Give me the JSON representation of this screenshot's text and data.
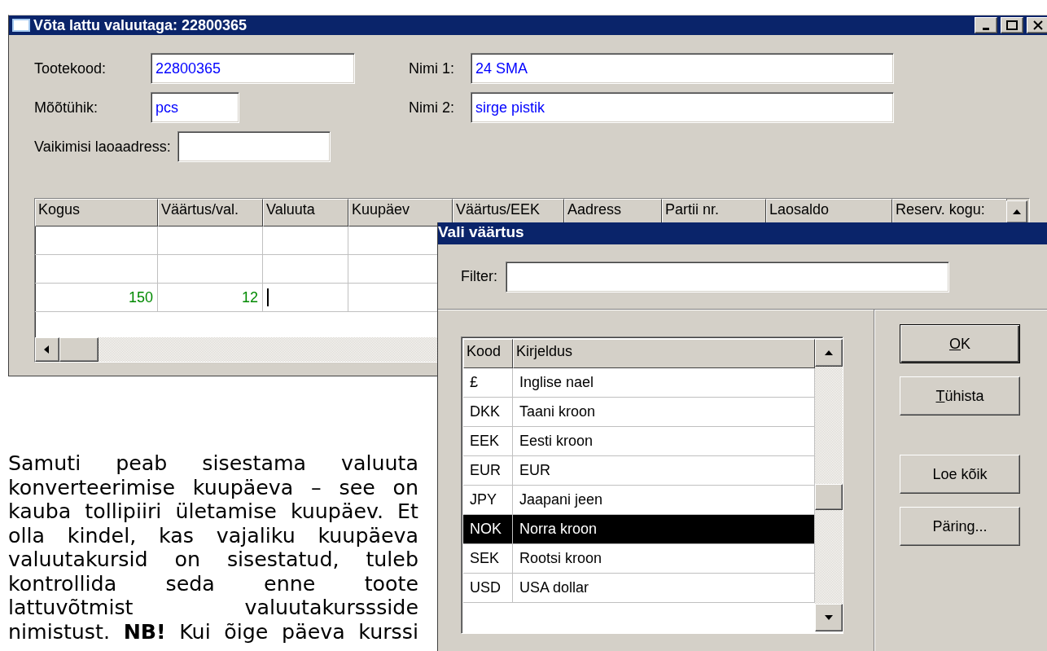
{
  "main_window": {
    "title": "Võta lattu valuutaga: 22800365",
    "left_fields": [
      {
        "label": "Tootekood:",
        "value": "22800365"
      },
      {
        "label": "Mõõtühik:",
        "value": "pcs"
      },
      {
        "label": "Vaikimisi laoaadress:"
      }
    ],
    "right_fields": [
      {
        "label": "Nimi 1:",
        "value": "24 SMA"
      },
      {
        "label": "Nimi 2:",
        "value": "sirge pistik"
      }
    ],
    "grid": {
      "columns": [
        "Kogus",
        "Väärtus/val.",
        "Valuuta",
        "Kuupäev",
        "Väärtus/EEK",
        "Aadress",
        "Partii nr.",
        "Laosaldo",
        "Reserv. kogu:"
      ],
      "rows": [
        {
          "kind": "blank"
        },
        {
          "kind": "blank"
        },
        {
          "kind": "entry",
          "cells": [
            "150",
            "12"
          ],
          "editing": true
        }
      ]
    }
  },
  "dialog": {
    "title": "Vali väärtus",
    "filter_label": "Filter:",
    "list": {
      "columns": [
        "Kood",
        "Kirjeldus"
      ],
      "rows": [
        {
          "code": "£",
          "description": "Inglise nael",
          "selected": false
        },
        {
          "code": "DKK",
          "description": "Taani kroon",
          "selected": false
        },
        {
          "code": "EEK",
          "description": "Eesti kroon",
          "selected": false
        },
        {
          "code": "EUR",
          "description": "EUR",
          "selected": false
        },
        {
          "code": "JPY",
          "description": "Jaapani jeen",
          "selected": false
        },
        {
          "code": "NOK",
          "description": "Norra kroon",
          "selected": true
        },
        {
          "code": "SEK",
          "description": "Rootsi kroon",
          "selected": false
        },
        {
          "code": "USD",
          "description": "USA dollar",
          "selected": false
        }
      ]
    },
    "buttons": [
      {
        "label": "OK",
        "default": true,
        "access_key_first": true
      },
      {
        "label": "Tühista",
        "default": false,
        "access_key_first": true
      },
      {
        "label": "Loe kõik",
        "default": false,
        "access_key_first": false
      },
      {
        "label": "Päring...",
        "default": false,
        "access_key_first": false
      }
    ]
  },
  "paragraph": "Samuti peab sisestama valuuta konverteerimise kuupäeva – see on kauba tollipiiri ületamise kuupäev. Et olla kindel, kas vajaliku kuupäeva valuutakursid on sisestatud, tuleb kontrollida seda enne toote lattuvõtmist valuutakurssside nimistust. **NB!** Kui õige päeva kurssi"
}
